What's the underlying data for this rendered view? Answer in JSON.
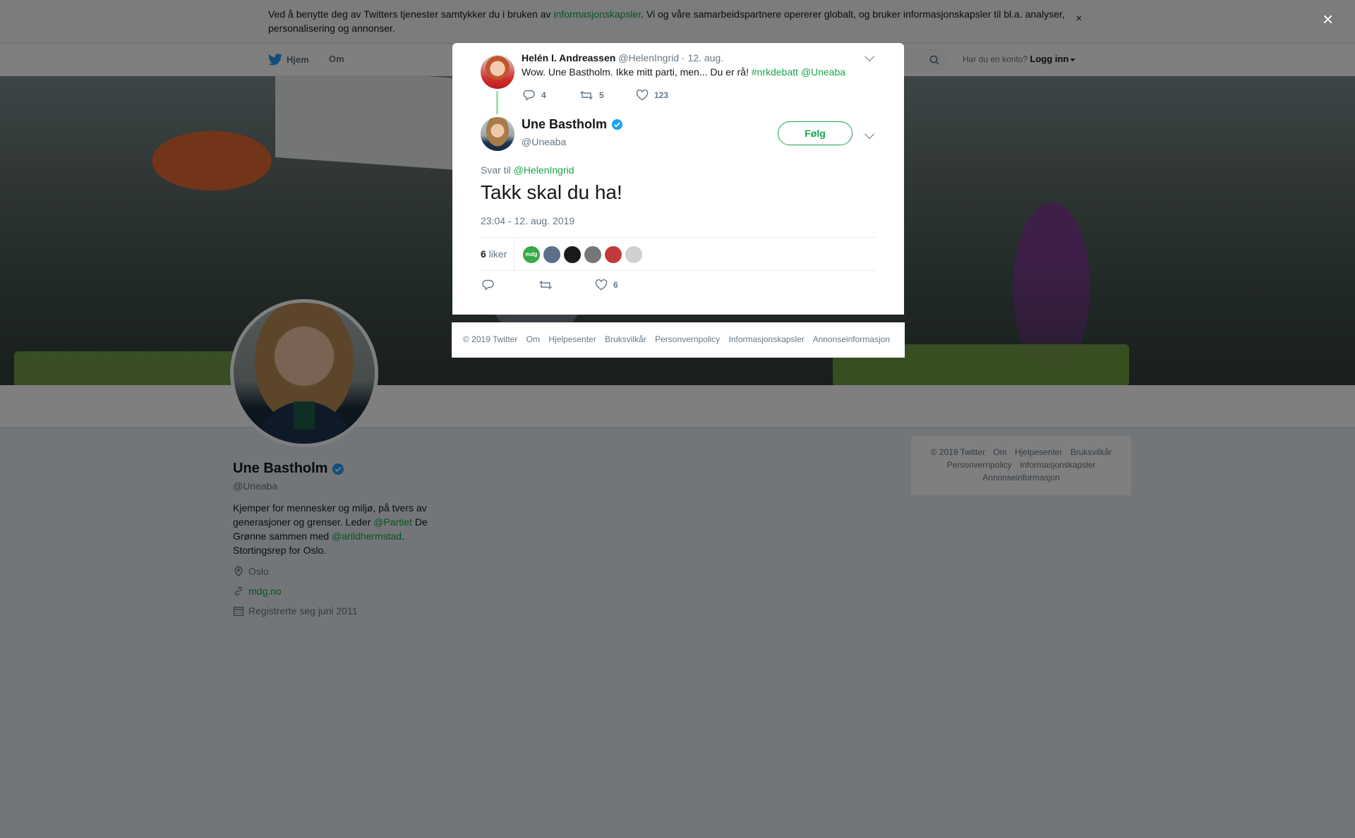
{
  "cookie_bar": {
    "text_before": "Ved å benytte deg av Twitters tjenester samtykker du i bruken av ",
    "link": "informasjonskapsler",
    "text_after": ". Vi og våre samarbeidspartnere opererer globalt, og bruker informasjonskapsler til bl.a. analyser, personalisering og annonser.",
    "close": "×"
  },
  "nav": {
    "home": "Hjem",
    "about": "Om",
    "account_prompt": "Har du en konto?",
    "login": "Logg inn"
  },
  "profile": {
    "name": "Une Bastholm",
    "handle": "@Uneaba",
    "bio_1": "Kjemper for mennesker og miljø, på tvers av generasjoner og grenser. Leder ",
    "bio_link_1": "@Partiet",
    "bio_2": " De Grønne sammen med ",
    "bio_link_2": "@arildhermstad",
    "bio_3": ". Stortingsrep for Oslo.",
    "location": "Oslo",
    "website": "mdg.no",
    "joined": "Registrerte seg juni 2011"
  },
  "side_footer": {
    "items": [
      "© 2019 Twitter",
      "Om",
      "Hjelpesenter",
      "Bruksvilkår",
      "Personvernpolicy",
      "Informasjonskapsler",
      "Annonseinformasjon"
    ]
  },
  "overlay": {
    "close": "×"
  },
  "parent_tweet": {
    "name": "Helén I. Andreassen",
    "handle": "@HelenIngrid",
    "date": "· 12. aug.",
    "text": "Wow. Une Bastholm. Ikke mitt parti, men... Du er rå! ",
    "hashtag": "#nrkdebatt",
    "mention": "@Uneaba",
    "replies": "4",
    "retweets": "5",
    "likes": "123"
  },
  "main_tweet": {
    "name": "Une Bastholm",
    "handle": "@Uneaba",
    "follow": "Følg",
    "reply_to_label": "Svar til ",
    "reply_to_handle": "@HelenIngrid",
    "text": "Takk skal du ha!",
    "timestamp": "23:04 - 12. aug. 2019",
    "likes_count": "6",
    "likes_label": " liker",
    "action_likes": "6"
  },
  "likers": [
    {
      "color": "#3aa845",
      "label": "mdg"
    },
    {
      "color": "#5c6f8a"
    },
    {
      "color": "#1a1a1a"
    },
    {
      "color": "#777777"
    },
    {
      "color": "#c23a3a"
    },
    {
      "color": "#d0d0d0"
    }
  ],
  "modal_footer": {
    "items": [
      "© 2019 Twitter",
      "Om",
      "Hjelpesenter",
      "Bruksvilkår",
      "Personvernpolicy",
      "Informasjonskapsler",
      "Annonseinformasjon"
    ]
  },
  "colors": {
    "accent": "#18a54a",
    "verified": "#1da1f2"
  }
}
